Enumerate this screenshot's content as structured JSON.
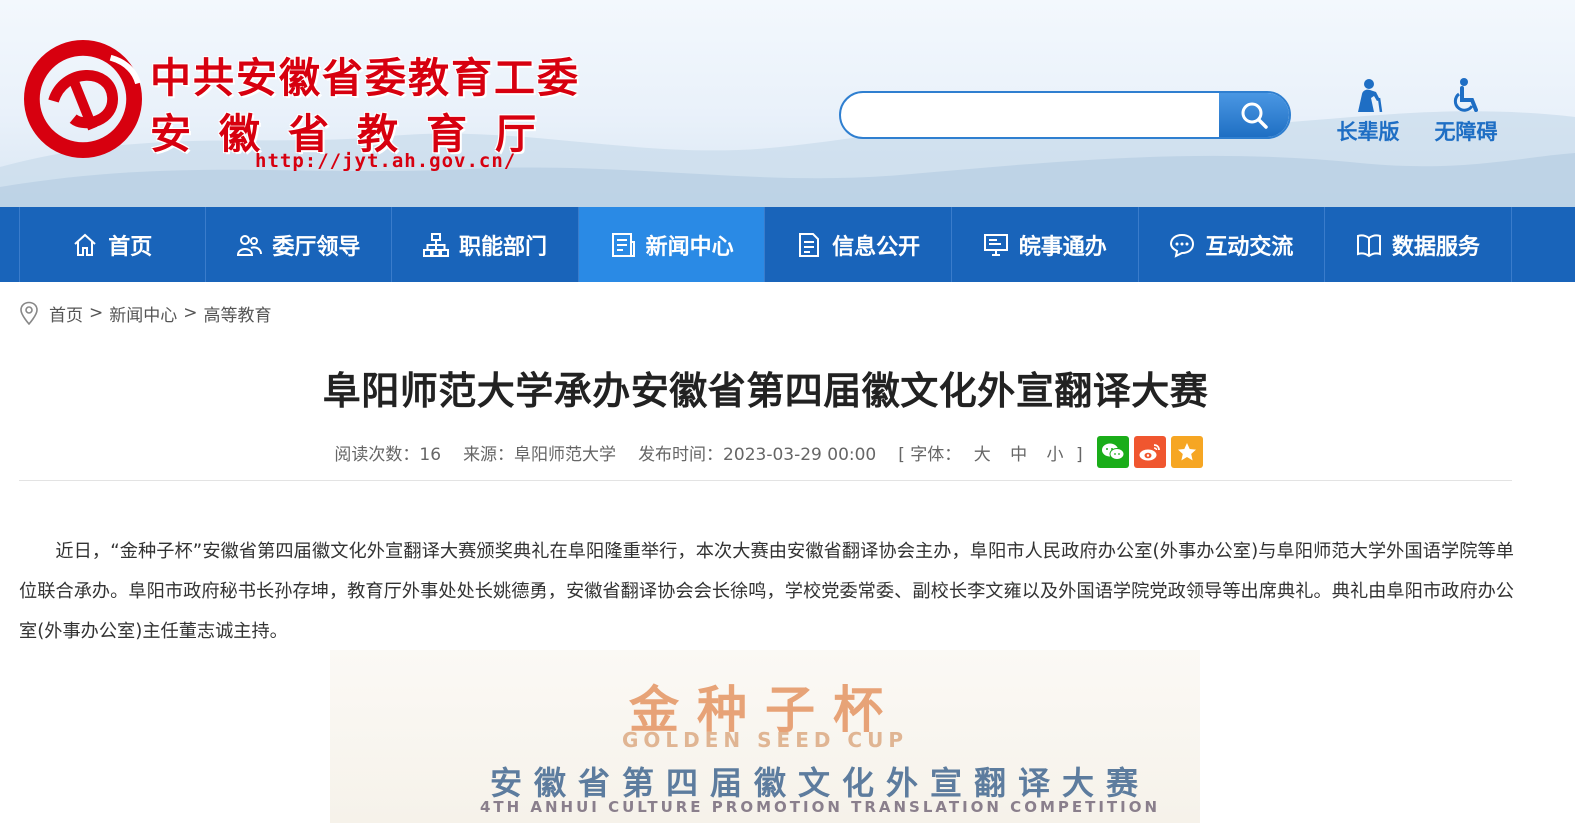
{
  "header": {
    "title_line1": "中共安徽省委教育工委",
    "title_line2": "安徽省教育厅",
    "url": "http://jyt.ah.gov.cn/",
    "search_placeholder": "",
    "tools": [
      {
        "label": "长辈版",
        "icon": "elder-icon"
      },
      {
        "label": "无障碍",
        "icon": "accessibility-icon"
      }
    ]
  },
  "nav": {
    "items": [
      {
        "label": "首页",
        "icon": "home-icon"
      },
      {
        "label": "委厅领导",
        "icon": "leaders-icon"
      },
      {
        "label": "职能部门",
        "icon": "org-chart-icon"
      },
      {
        "label": "新闻中心",
        "icon": "news-icon",
        "active": true
      },
      {
        "label": "信息公开",
        "icon": "document-icon"
      },
      {
        "label": "皖事通办",
        "icon": "service-monitor-icon"
      },
      {
        "label": "互动交流",
        "icon": "chat-icon"
      },
      {
        "label": "数据服务",
        "icon": "book-icon"
      }
    ]
  },
  "breadcrumb": {
    "items": [
      "首页",
      "新闻中心",
      "高等教育"
    ],
    "separator": ">"
  },
  "article": {
    "title": "阜阳师范大学承办安徽省第四届徽文化外宣翻译大赛",
    "views": "阅读次数：16",
    "source": "来源：阜阳师范大学",
    "published": "发布时间：2023-03-29 00:00",
    "font_label": "[ 字体：",
    "font_large": "大",
    "font_medium": "中",
    "font_small": "小",
    "font_close": "]",
    "share": [
      {
        "name": "wechat",
        "color": "#1aad19"
      },
      {
        "name": "weibo",
        "color": "#f0562f"
      },
      {
        "name": "favorite",
        "color": "#f6a623"
      }
    ],
    "paragraph": "近日，“金种子杯”安徽省第四届徽文化外宣翻译大赛颁奖典礼在阜阳隆重举行，本次大赛由安徽省翻译协会主办，阜阳市人民政府办公室(外事办公室)与阜阳师范大学外国语学院等单位联合承办。阜阳市政府秘书长孙存坤，教育厅外事处处长姚德勇，安徽省翻译协会会长徐鸣，学校党委常委、副校长李文雍以及外国语学院党政领导等出席典礼。典礼由阜阳市政府办公室(外事办公室)主任董志诚主持。"
  },
  "poster": {
    "title_cn": "金种子杯",
    "title_en": "GOLDEN SEED CUP",
    "subtitle_cn": "安徽省第四届徽文化外宣翻译大赛",
    "subtitle_en": "4TH ANHUI CULTURE PROMOTION TRANSLATION COMPETITION"
  },
  "colors": {
    "brand_red": "#d7000f",
    "nav_blue": "#1964ba",
    "nav_active": "#2a8ae5",
    "link_blue": "#1e6ec4"
  }
}
